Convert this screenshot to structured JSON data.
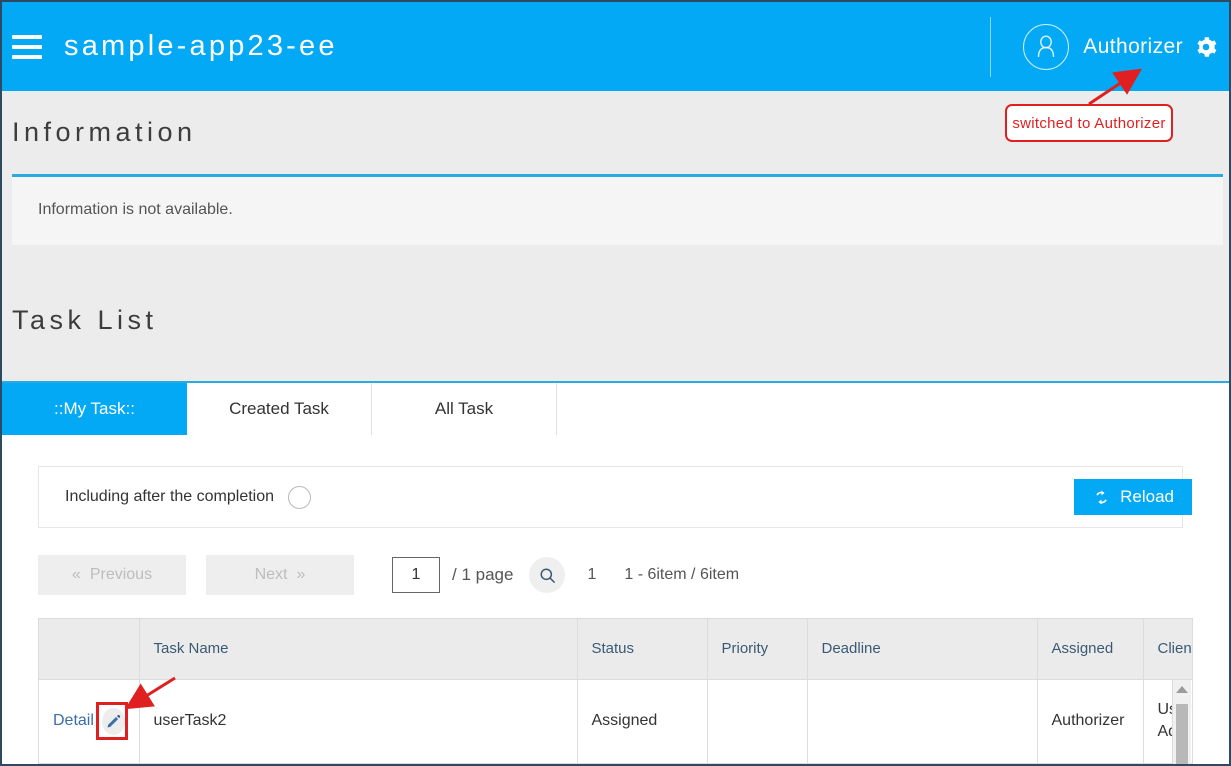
{
  "appbar": {
    "menu_icon": "hamburger-icon",
    "title": "sample-app23-ee",
    "user_name": "Authorizer",
    "avatar_icon": "user-avatar-icon",
    "settings_icon": "gear-icon"
  },
  "information": {
    "title": "Information",
    "message": "Information is not available."
  },
  "tasklist": {
    "title": "Task List",
    "tabs": [
      {
        "label": "::My Task::",
        "active": true
      },
      {
        "label": "Created Task",
        "active": false
      },
      {
        "label": "All Task",
        "active": false
      }
    ],
    "filter": {
      "label": "Including after the completion",
      "toggle_checked": false,
      "reload_label": "Reload",
      "reload_icon": "refresh-icon"
    },
    "pagination": {
      "previous_label": "Previous",
      "previous_chevron": "«",
      "next_label": "Next",
      "next_chevron": "»",
      "page_input_value": "1",
      "page_of": "/ 1 page",
      "search_icon": "search-icon",
      "current_page": "1",
      "item_range": "1 - 6item / 6item"
    },
    "table": {
      "columns": [
        "",
        "Task Name",
        "Status",
        "Priority",
        "Deadline",
        "Assigned",
        "Client"
      ],
      "rows": [
        {
          "detail_label": "Detail",
          "edit_icon": "pencil-edit-icon",
          "task_name": "userTask2",
          "status": "Assigned",
          "priority": "",
          "deadline": "",
          "assigned": "Authorizer",
          "client": "User Adm"
        }
      ]
    }
  },
  "annotations": [
    {
      "text": "switched to Authorizer"
    }
  ],
  "colors": {
    "accent": "#03a9f4",
    "rule": "#29abe2",
    "section_bg": "#ececec",
    "annotation": "#e02020",
    "link": "#3a6ea5",
    "header_text": "#3a5a73"
  }
}
